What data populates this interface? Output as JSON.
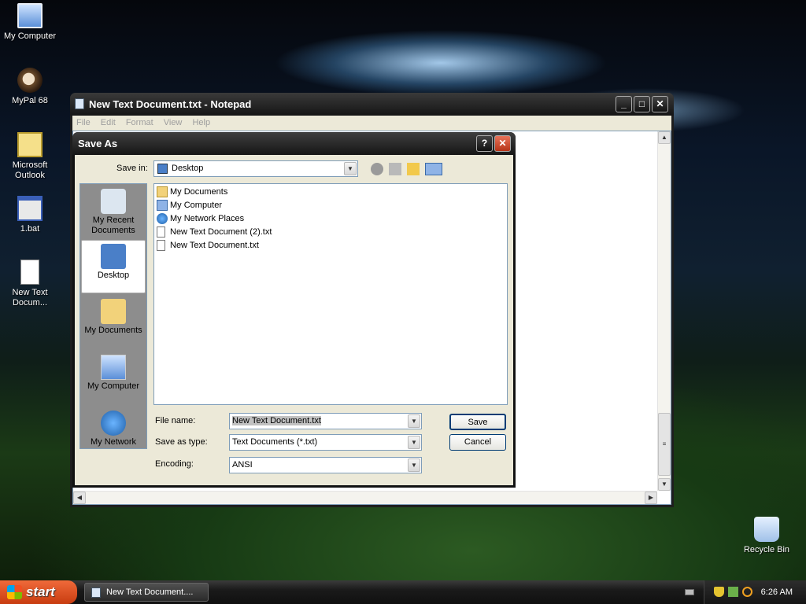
{
  "desktop": {
    "icons": [
      {
        "label": "My Computer"
      },
      {
        "label": "MyPal 68"
      },
      {
        "label": "Microsoft Outlook"
      },
      {
        "label": "1.bat"
      },
      {
        "label": "New Text Docum..."
      },
      {
        "label": "Recycle Bin"
      }
    ]
  },
  "notepad": {
    "title": "New Text Document.txt - Notepad",
    "menu": [
      "File",
      "Edit",
      "Format",
      "View",
      "Help"
    ]
  },
  "dialog": {
    "title": "Save As",
    "save_in_label": "Save in:",
    "save_in_value": "Desktop",
    "places": [
      {
        "label": "My Recent Documents"
      },
      {
        "label": "Desktop"
      },
      {
        "label": "My Documents"
      },
      {
        "label": "My Computer"
      },
      {
        "label": "My Network"
      }
    ],
    "files": [
      {
        "name": "My Documents",
        "icon": "folder-icon"
      },
      {
        "name": "My Computer",
        "icon": "computer-icon"
      },
      {
        "name": "My Network Places",
        "icon": "network-icon"
      },
      {
        "name": "New Text Document (2).txt",
        "icon": "text-file-icon"
      },
      {
        "name": "New Text Document.txt",
        "icon": "text-file-icon"
      }
    ],
    "file_name_label": "File name:",
    "file_name_value": "New Text Document.txt",
    "save_type_label": "Save as type:",
    "save_type_value": "Text Documents (*.txt)",
    "encoding_label": "Encoding:",
    "encoding_value": "ANSI",
    "save_button": "Save",
    "cancel_button": "Cancel",
    "help_button": "?",
    "close_button": "✕"
  },
  "taskbar": {
    "start_label": "start",
    "task_label": "New Text Document....",
    "clock": "6:26 AM"
  }
}
